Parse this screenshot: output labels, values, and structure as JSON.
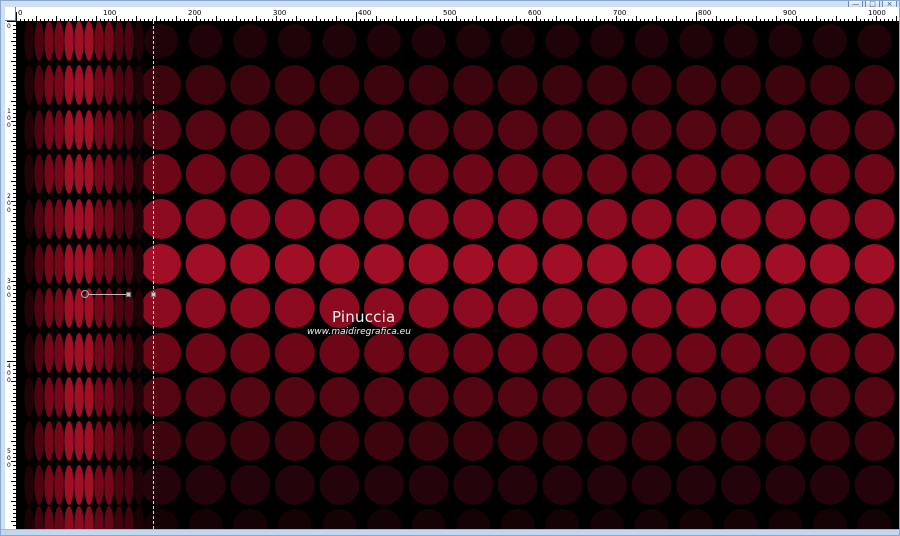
{
  "window": {
    "title_fragment": "",
    "controls": [
      "—",
      "□",
      "×"
    ]
  },
  "rulers": {
    "top_labels": [
      "0",
      "100",
      "200",
      "300",
      "400",
      "500",
      "600",
      "700",
      "800",
      "900",
      "1000"
    ],
    "left_labels": [
      "0",
      "100",
      "200",
      "300",
      "400",
      "500"
    ]
  },
  "watermark": {
    "name": "Pinuccia",
    "url": "www.maidiregrafica.eu"
  },
  "colors": {
    "canvas_background": "#000000",
    "accent_red": "#a40f25",
    "dark_red": "#2a0308",
    "guide_line": "#d8d8d8"
  },
  "icons": {
    "handle": "target-handle-icon",
    "square": "transform-square-icon"
  }
}
